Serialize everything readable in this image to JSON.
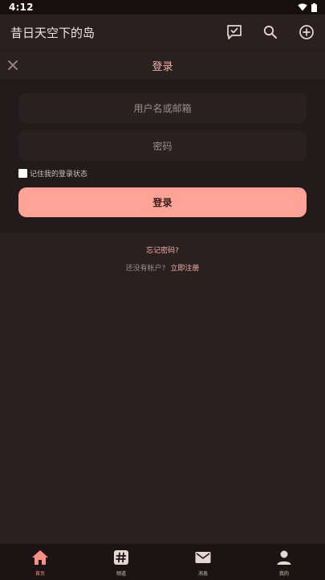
{
  "status_bar": {
    "time": "4:12"
  },
  "app_bar": {
    "title": "昔日天空下的岛"
  },
  "login": {
    "title": "登录",
    "username_placeholder": "用户名或邮箱",
    "password_placeholder": "密码",
    "remember_label": "记住我的登录状态",
    "remember_checked": false,
    "submit_label": "登录",
    "forgot_link": "忘记密码?",
    "no_account_text": "还没有帐户?",
    "register_link": "立即注册"
  },
  "bottom_nav": {
    "items": [
      {
        "label": "首页",
        "icon": "home-icon",
        "active": true
      },
      {
        "label": "频道",
        "icon": "hashtag-icon",
        "active": false
      },
      {
        "label": "消息",
        "icon": "mail-icon",
        "active": false
      },
      {
        "label": "我的",
        "icon": "person-icon",
        "active": false
      }
    ]
  },
  "colors": {
    "background": "#2b2020",
    "panel": "#231b1b",
    "accent": "#ffa398",
    "accent_text": "#f0b1a8",
    "active_nav": "#ff8f84"
  }
}
